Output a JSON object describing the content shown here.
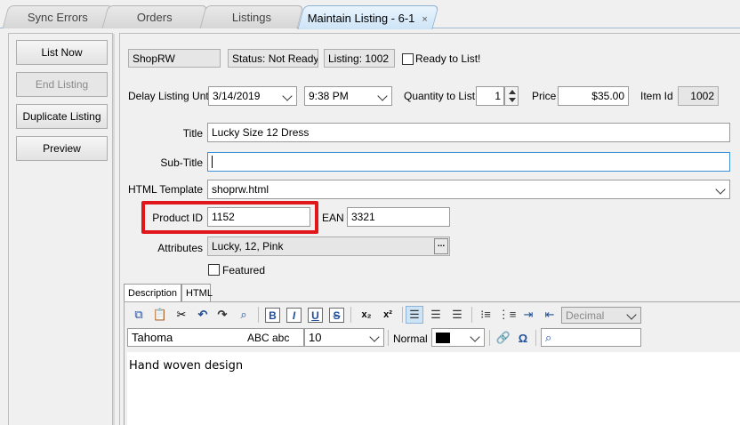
{
  "tabs": [
    {
      "label": "Sync Errors"
    },
    {
      "label": "Orders"
    },
    {
      "label": "Listings"
    },
    {
      "label": "Maintain Listing - 6-1",
      "close": "×"
    }
  ],
  "left_buttons": {
    "list_now": "List Now",
    "end_listing": "End Listing",
    "duplicate": "Duplicate Listing",
    "preview": "Preview"
  },
  "header": {
    "account": "ShopRW",
    "status": "Status: Not Ready",
    "listing": "Listing: 1002",
    "ready_label": "Ready to List!"
  },
  "schedule": {
    "delay_label": "Delay Listing Until",
    "date": "3/14/2019",
    "time": "9:38 PM",
    "qty_label": "Quantity to List",
    "qty": "1",
    "price_label": "Price",
    "price": "$35.00",
    "itemid_label": "Item Id",
    "itemid": "1002"
  },
  "fields": {
    "title_label": "Title",
    "title": "Lucky Size 12 Dress",
    "subtitle_label": "Sub-Title",
    "subtitle": "",
    "template_label": "HTML Template",
    "template": "shoprw.html",
    "productid_label": "Product ID",
    "productid": "1152",
    "ean_label": "EAN",
    "ean": "3321",
    "attributes_label": "Attributes",
    "attributes": "Lucky, 12, Pink",
    "featured_label": "Featured"
  },
  "editor": {
    "tab_description": "Description",
    "tab_html": "HTML",
    "font": "Tahoma",
    "font_preview": "ABC abc",
    "size": "10",
    "style": "Normal",
    "list_format": "Decimal",
    "content": "Hand woven design"
  },
  "colors": {
    "highlight": "#e0161b",
    "active_tab": "#cde4f7"
  }
}
